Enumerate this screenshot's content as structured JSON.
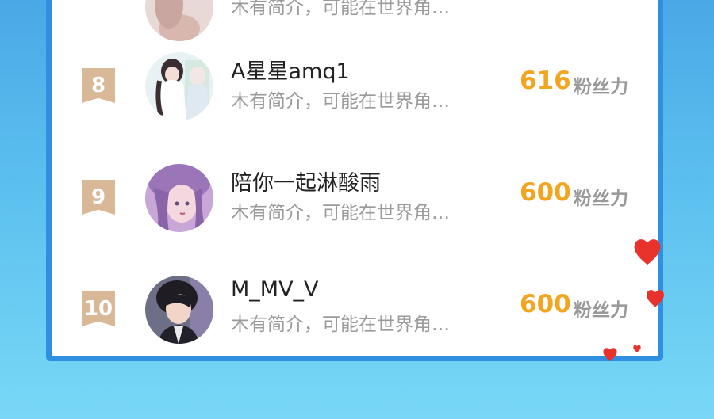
{
  "fans_list": [
    {
      "rank": "",
      "name": "",
      "intro": "木有简介，可能在世界角…",
      "score": "",
      "unit": ""
    },
    {
      "rank": "8",
      "name": "A星星amq1",
      "intro": "木有简介，可能在世界角…",
      "score": "616",
      "unit": "粉丝力"
    },
    {
      "rank": "9",
      "name": "陪你一起淋酸雨",
      "intro": "木有简介，可能在世界角…",
      "score": "600",
      "unit": "粉丝力"
    },
    {
      "rank": "10",
      "name": "M_MV_V",
      "intro": "木有简介，可能在世界角…",
      "score": "600",
      "unit": "粉丝力"
    }
  ],
  "colors": {
    "score": "#f3a51f",
    "rank_badge": "#d9b898",
    "card_border": "#2f8fe0",
    "heart": "#e8322c"
  }
}
